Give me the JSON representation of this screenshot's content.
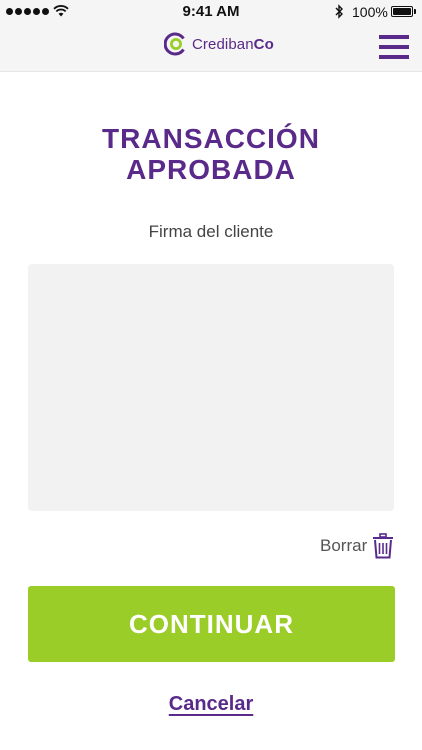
{
  "status_bar": {
    "time": "9:41 AM",
    "battery": "100%",
    "signal_bars": 5,
    "battery_level": 1.0,
    "icons": [
      "signal-dots-icon",
      "wifi-icon",
      "bluetooth-icon",
      "battery-icon"
    ]
  },
  "header": {
    "logo_text_regular": "Crediban",
    "logo_text_bold": "Co",
    "menu_icon": "hamburger-menu-icon"
  },
  "content": {
    "title_line1": "TRANSACCIÓN",
    "title_line2": "APROBADA",
    "signature_label": "Firma del cliente",
    "clear_label": "Borrar",
    "clear_icon": "trash-icon",
    "continue_label": "CONTINUAR",
    "cancel_label": "Cancelar"
  },
  "colors": {
    "primary_purple": "#5a2a8a",
    "accent_green": "#9acd27",
    "signature_bg": "#f2f2f2",
    "header_bg": "#f5f5f5"
  }
}
